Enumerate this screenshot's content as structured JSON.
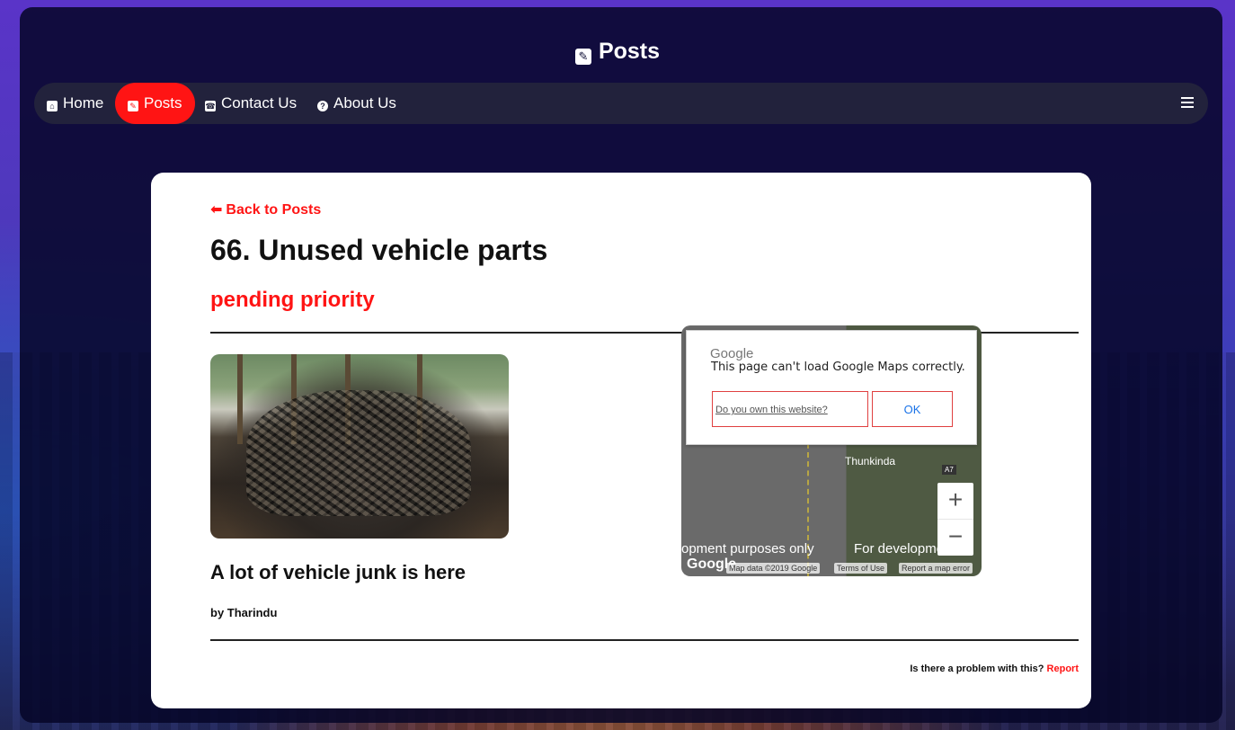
{
  "header": {
    "title": "Posts",
    "title_icon": "pencil-square-icon"
  },
  "nav": {
    "items": [
      {
        "label": "Home",
        "icon": "home-icon"
      },
      {
        "label": "Posts",
        "icon": "pencil-square-icon",
        "active": true
      },
      {
        "label": "Contact Us",
        "icon": "phone-icon"
      },
      {
        "label": "About Us",
        "icon": "question-circle-icon"
      }
    ],
    "menu_icon": "hamburger-icon"
  },
  "post": {
    "back_label": "Back to Posts",
    "title": "66. Unused vehicle parts",
    "status": "pending priority",
    "subheading": "A lot of vehicle junk is here",
    "byline": "by Tharindu"
  },
  "map": {
    "google_label": "Google",
    "error_message": "This page can't load Google Maps correctly.",
    "own_site_link": "Do you own this website?",
    "ok_label": "OK",
    "place_label": "Thunkinda",
    "road_label": "A7",
    "dev_text_left": "opment purposes only",
    "dev_text_right": "For development p",
    "zoom_in": "+",
    "zoom_out": "−",
    "logo": "Google",
    "attribution": "Map data ©2019 Google",
    "terms": "Terms of Use",
    "report_error": "Report a map error"
  },
  "footer": {
    "problem_text": "Is there a problem with this?",
    "report_label": "Report"
  },
  "colors": {
    "accent": "#ff1414",
    "nav_bg": "#22223c",
    "overlay": "#06062a"
  }
}
